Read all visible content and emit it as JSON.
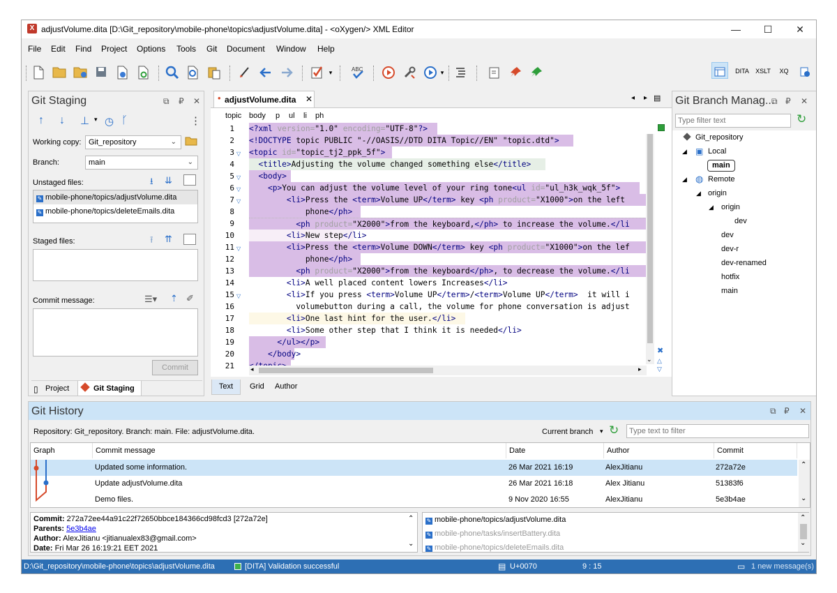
{
  "window": {
    "title": "adjustVolume.dita [D:\\Git_repository\\mobile-phone\\topics\\adjustVolume.dita] - <oXygen/> XML Editor",
    "minimize": "—",
    "maximize": "☐",
    "close": "✕"
  },
  "menu": [
    "File",
    "Edit",
    "Find",
    "Project",
    "Options",
    "Tools",
    "Git",
    "Document",
    "Window",
    "Help"
  ],
  "perspective": {
    "dita": "DITA",
    "xslt": "XSLT",
    "xq": "XQ"
  },
  "staging": {
    "title": "Git Staging",
    "working_copy_label": "Working copy:",
    "working_copy": "Git_repository",
    "branch_label": "Branch:",
    "branch": "main",
    "unstaged_label": "Unstaged files:",
    "unstaged": [
      "mobile-phone/topics/adjustVolume.dita",
      "mobile-phone/topics/deleteEmails.dita"
    ],
    "staged_label": "Staged files:",
    "commit_label": "Commit message:",
    "commit_button": "Commit",
    "tab_project": "Project",
    "tab_staging": "Git Staging"
  },
  "editor": {
    "tab": "adjustVolume.dita",
    "breadcrumb": [
      "topic",
      "body",
      "p",
      "ul",
      "li",
      "ph"
    ],
    "lines": [
      {
        "n": "1",
        "t": "<?xml version=\"1.0\" encoding=\"UTF-8\"?>"
      },
      {
        "n": "2",
        "t": "<!DOCTYPE topic PUBLIC \"-//OASIS//DTD DITA Topic//EN\" \"topic.dtd\">"
      },
      {
        "n": "3",
        "t": "<topic id=\"topic_tj2_ppk_5f\">"
      },
      {
        "n": "4",
        "t": "  <title>Adjusting the volume changed something else</title>"
      },
      {
        "n": "5",
        "t": "  <body>"
      },
      {
        "n": "6",
        "t": "    <p>You can adjust the volume level of your ring tone<ul id=\"ul_h3k_wqk_5f\">"
      },
      {
        "n": "7",
        "t": "        <li>Press the <term>Volume UP</term> key <ph product=\"X1000\">on the left"
      },
      {
        "n": "8",
        "t": "            phone</ph>"
      },
      {
        "n": "9",
        "t": "          <ph product=\"X2000\">from the keyboard,</ph> to increase the volume.</li"
      },
      {
        "n": "10",
        "t": "        <li>New step</li>"
      },
      {
        "n": "11",
        "t": "        <li>Press the <term>Volume DOWN</term> key <ph product=\"X1000\">on the lef"
      },
      {
        "n": "12",
        "t": "            phone</ph>"
      },
      {
        "n": "13",
        "t": "          <ph product=\"X2000\">from the keyboard</ph>, to decrease the volume.</li"
      },
      {
        "n": "14",
        "t": "        <li>A well placed content lowers Increases</li>"
      },
      {
        "n": "15",
        "t": "        <li>If you press <term>Volume UP</term>/<term>Volume UP</term>  it will i"
      },
      {
        "n": "16",
        "t": "          volumebutton during a call, the volume for phone conversation is adjust"
      },
      {
        "n": "17",
        "t": "        <li>One last hint for the user.</li>"
      },
      {
        "n": "18",
        "t": "        <li>Some other step that I think it is needed</li>"
      },
      {
        "n": "19",
        "t": "      </ul></p>"
      },
      {
        "n": "20",
        "t": "    </body>"
      },
      {
        "n": "21",
        "t": "</topic>"
      }
    ],
    "modes": [
      "Text",
      "Grid",
      "Author"
    ]
  },
  "branch": {
    "title": "Git Branch Manag...",
    "filter_placeholder": "Type filter text",
    "repo": "Git_repository",
    "local": "Local",
    "local_main": "main",
    "remote": "Remote",
    "origin": "origin",
    "origin2": "origin",
    "branches_origin2": [
      "dev"
    ],
    "branches_origin": [
      "dev",
      "dev-r",
      "dev-renamed",
      "hotfix",
      "main"
    ]
  },
  "history": {
    "title": "Git History",
    "info": "Repository: Git_repository. Branch: main. File: adjustVolume.dita.",
    "current_branch": "Current branch",
    "filter_placeholder": "Type text to filter",
    "columns": [
      "Graph",
      "Commit message",
      "Date",
      "Author",
      "Commit"
    ],
    "rows": [
      {
        "msg": "Updated some information.",
        "date": "26 Mar 2021 16:19",
        "author": "AlexJitianu",
        "commit": "272a72e"
      },
      {
        "msg": "Update adjustVolume.dita",
        "date": "26 Mar 2021 16:18",
        "author": "Alex Jitianu",
        "commit": "51383f6"
      },
      {
        "msg": "Demo files.",
        "date": "9 Nov 2020 16:55",
        "author": "AlexJitianu",
        "commit": "5e3b4ae"
      }
    ],
    "detail": {
      "commit_label": "Commit:",
      "commit": "272a72ee44a91c22f72650bbce184366cd98fcd3 [272a72e]",
      "parents_label": "Parents:",
      "parents": "5e3b4ae",
      "author_label": "Author:",
      "author": "AlexJitianu <jitianualex83@gmail.com>",
      "date_label": "Date:",
      "date": "Fri Mar 26 16:19:21 EET 2021"
    },
    "files": [
      "mobile-phone/topics/adjustVolume.dita",
      "mobile-phone/tasks/insertBattery.dita",
      "mobile-phone/topics/deleteEmails.dita"
    ]
  },
  "status": {
    "path": "D:\\Git_repository\\mobile-phone\\topics\\adjustVolume.dita",
    "validation": "[DITA] Validation successful",
    "unicode": "U+0070",
    "pos": "9 : 15",
    "messages": "1 new message(s)"
  }
}
